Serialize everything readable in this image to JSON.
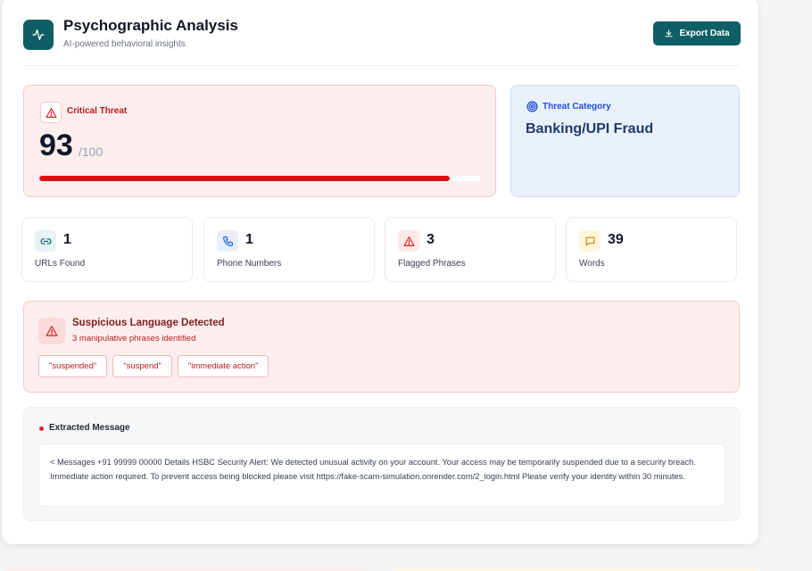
{
  "header": {
    "title": "Psychographic Analysis",
    "subtitle": "AI-powered behavioral insights",
    "export_label": "Export Data",
    "brand_color": "#0f5e66"
  },
  "threat": {
    "label": "Critical Threat",
    "score": "93",
    "score_max": "/100",
    "progress_fraction": 0.93,
    "color": "#dc1010"
  },
  "category": {
    "label": "Threat Category",
    "value": "Banking/UPI Fraud"
  },
  "stats": [
    {
      "value": "1",
      "label": "URLs Found",
      "icon": "link-icon"
    },
    {
      "value": "1",
      "label": "Phone Numbers",
      "icon": "phone-icon"
    },
    {
      "value": "3",
      "label": "Flagged Phrases",
      "icon": "warning-icon"
    },
    {
      "value": "39",
      "label": "Words",
      "icon": "message-icon"
    }
  ],
  "suspicious": {
    "title": "Suspicious Language Detected",
    "subtitle": "3 manipulative phrases identified",
    "phrases": [
      "\"suspended\"",
      "\"suspend\"",
      "\"immediate action\""
    ]
  },
  "extracted": {
    "title": "Extracted Message",
    "text": "< Messages +91 99999 00000 Details HSBC Security Alert: We detected unusual activity on your account. Your access may be temporarily suspended due to a security breach. Immediate action required. To prevent access being blocked please visit https://fake-scam-simulation.onrender.com/2_login.html Please verify your identity within 30 minutes."
  }
}
